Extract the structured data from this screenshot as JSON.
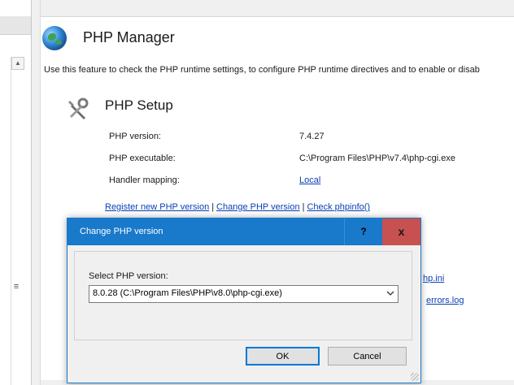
{
  "header": {
    "title": "PHP Manager",
    "description": "Use this feature to check the PHP runtime settings, to configure PHP runtime directives and to enable or disab"
  },
  "setup": {
    "title": "PHP Setup",
    "rows": [
      {
        "label": "PHP version:",
        "value": "7.4.27"
      },
      {
        "label": "PHP executable:",
        "value": "C:\\Program Files\\PHP\\v7.4\\php-cgi.exe"
      },
      {
        "label": "Handler mapping:",
        "value": "Local"
      }
    ],
    "links": {
      "register": "Register new PHP version",
      "change": "Change PHP version",
      "phpinfo": "Check phpinfo()",
      "separator": "|"
    }
  },
  "background_links": {
    "ini": "hp.ini",
    "errors": "errors.log"
  },
  "dialog": {
    "title": "Change PHP version",
    "help_label": "?",
    "close_label": "x",
    "select_label": "Select PHP version:",
    "selected_value": "8.0.28 (C:\\Program Files\\PHP\\v8.0\\php-cgi.exe)",
    "ok_label": "OK",
    "cancel_label": "Cancel"
  },
  "colors": {
    "titlebar": "#1979ca",
    "close": "#c75050",
    "link": "#0a3fb4"
  },
  "icons": {
    "page": "globe-icon",
    "section": "tools-icon",
    "select": "chevron-down-icon"
  }
}
